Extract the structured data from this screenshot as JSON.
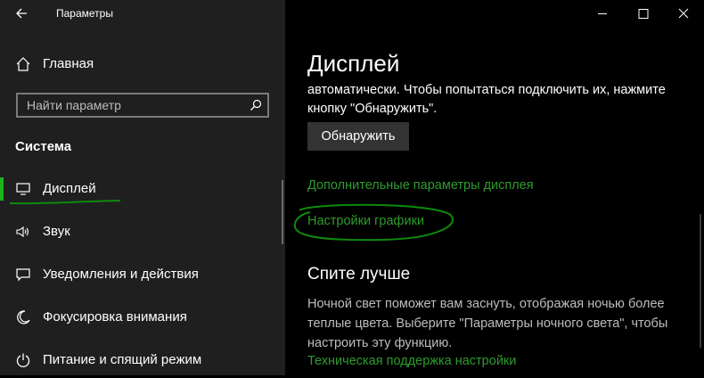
{
  "window": {
    "title": "Параметры"
  },
  "sidebar": {
    "home_label": "Главная",
    "search_placeholder": "Найти параметр",
    "section_title": "Система",
    "items": [
      {
        "label": "Дисплей",
        "icon": "monitor-icon",
        "selected": true
      },
      {
        "label": "Звук",
        "icon": "speaker-icon"
      },
      {
        "label": "Уведомления и действия",
        "icon": "notification-icon"
      },
      {
        "label": "Фокусировка внимания",
        "icon": "moon-icon"
      },
      {
        "label": "Питание и спящий режим",
        "icon": "power-icon"
      }
    ]
  },
  "main": {
    "page_title": "Дисплей",
    "intro_text_line1": "автоматически. Чтобы попытаться подключить их, нажмите",
    "intro_text_line2": "кнопку \"Обнаружить\".",
    "detect_button": "Обнаружить",
    "link_advanced": "Дополнительные параметры дисплея",
    "link_graphics": "Настройки графики",
    "sleep_title": "Спите лучше",
    "sleep_text": "Ночной свет поможет вам заснуть, отображая ночью более теплые цвета. Выберите \"Параметры ночного света\", чтобы настроить эту функцию.",
    "link_support": "Техническая поддержка настройки"
  },
  "colors": {
    "accent_green": "#2e9b2e",
    "sidebar_bg": "#1f1f1f",
    "main_bg": "#000000"
  }
}
